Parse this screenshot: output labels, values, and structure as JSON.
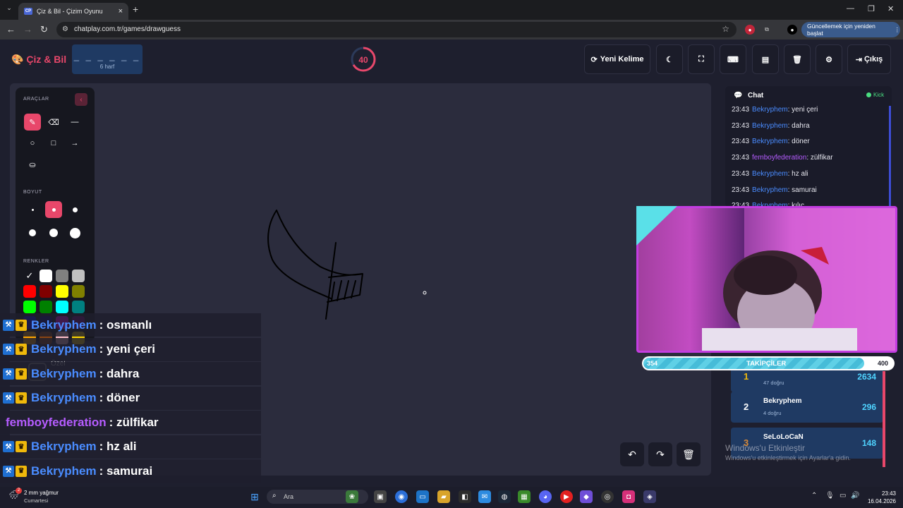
{
  "browser": {
    "tab_title": "Çiz & Bil - Çizim Oyunu",
    "tab_favicon": "CP",
    "url": "chatplay.com.tr/games/drawguess",
    "update_label": "Güncellemek için yeniden başlat"
  },
  "header": {
    "logo_text": "Çiz & Bil",
    "word_mask": "_ _ _ _ _ _",
    "word_length": "6 harf",
    "timer": "40",
    "new_word_label": "Yeni Kelime",
    "exit_label": "Çıkış"
  },
  "tools": {
    "section_tools": "ARAÇLAR",
    "section_size": "BOYUT",
    "section_colors": "RENKLER",
    "custom_label": "Özel",
    "active_tool": "pen",
    "active_size": 2,
    "colors": [
      "#ffffff",
      "#ffffff",
      "#808080",
      "#c0c0c0",
      "#ff0000",
      "#800000",
      "#ffff00",
      "#808000",
      "#00ff00",
      "#008000",
      "#00ffff",
      "#008080",
      "#0000ff",
      "#000080",
      "#ff00ff",
      "#800080",
      "#ffa500",
      "#8b4513",
      "#ffc0cb",
      "#ffd700"
    ]
  },
  "chat": {
    "title": "Chat",
    "status": "Kick",
    "messages": [
      {
        "time": "23:43",
        "user": "Bekryphem",
        "text": ": yeni çeri"
      },
      {
        "time": "23:43",
        "user": "Bekryphem",
        "text": ": dahra"
      },
      {
        "time": "23:43",
        "user": "Bekryphem",
        "text": ": döner"
      },
      {
        "time": "23:43",
        "user": "femboyfederation",
        "text": ": zülfikar"
      },
      {
        "time": "23:43",
        "user": "Bekryphem",
        "text": ": hz ali"
      },
      {
        "time": "23:43",
        "user": "Bekryphem",
        "text": ": samurai"
      },
      {
        "time": "23:43",
        "user": "Bekryphem",
        "text": ": kılıç"
      }
    ]
  },
  "followers": {
    "label": "TAKİPÇİLER",
    "current": "354",
    "goal": "400",
    "progress": 0.885
  },
  "leaderboard": [
    {
      "rank": "1",
      "name": "",
      "sub": "47 doğru",
      "score": "2634"
    },
    {
      "rank": "2",
      "name": "Bekryphem",
      "sub": "4 doğru",
      "score": "296"
    },
    {
      "rank": "3",
      "name": "SeLoLoCaN",
      "sub": "",
      "score": "148"
    }
  ],
  "windows_activate": {
    "title": "Windows'u Etkinleştir",
    "subtitle": "Windows'u etkinleştirmek için Ayarlar'a gidin."
  },
  "overlay_chat": [
    {
      "user": "Bekryphem",
      "text": ": osmanlı",
      "badges": true
    },
    {
      "user": "Bekryphem",
      "text": ": yeni çeri",
      "badges": true
    },
    {
      "user": "Bekryphem",
      "text": ": dahra",
      "badges": true
    },
    {
      "user": "Bekryphem",
      "text": ": döner",
      "badges": true
    },
    {
      "user": "femboyfederation",
      "text": ": zülfikar",
      "badges": false
    },
    {
      "user": "Bekryphem",
      "text": ": hz ali",
      "badges": true
    },
    {
      "user": "Bekryphem",
      "text": ": samurai",
      "badges": true
    }
  ],
  "taskbar": {
    "weather_temp": "2 mm yağmur",
    "weather_day": "Cumartesi",
    "weather_badge": "2",
    "search_placeholder": "Ara",
    "time": "23:43",
    "date": "16.04.2026"
  }
}
